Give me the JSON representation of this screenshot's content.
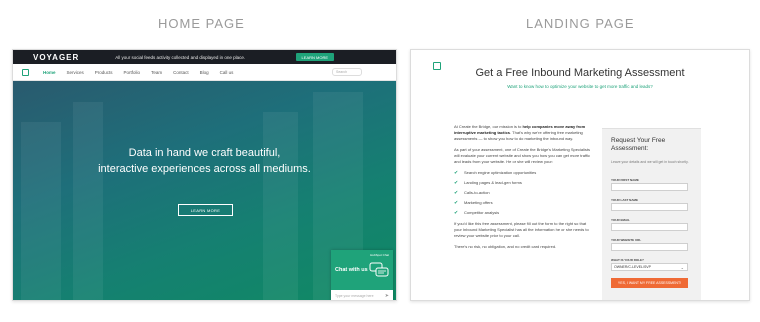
{
  "captions": {
    "home": "HOME PAGE",
    "landing": "LANDING PAGE"
  },
  "home": {
    "topbar": {
      "logo": "VOYAGER",
      "message": "All your social feeds activity collected and displayed in one place.",
      "button": "LEARN MORE"
    },
    "nav": {
      "items": [
        "Home",
        "Services",
        "Products",
        "Portfolio",
        "Team",
        "Contact",
        "Blog",
        "Call us"
      ],
      "search_placeholder": "Search"
    },
    "hero": {
      "line1": "Data in hand we craft beautiful,",
      "line2": "interactive experiences across all mediums.",
      "button": "LEARN MORE"
    },
    "chat": {
      "tag": "HubSpot Chat",
      "title": "Chat with us",
      "input_placeholder": "Type your message here"
    }
  },
  "landing": {
    "title": "Get a Free Inbound Marketing Assessment",
    "subtitle": "Want to know how to optimize your website to get more traffic and leads?",
    "body": {
      "p1_start": "At Create the Bridge, our mission is to ",
      "p1_bold": "help companies move away from interruptive marketing tactics",
      "p1_end": ". That's why we're offering free marketing assessments — to show you how to do marketing the inbound way.",
      "p2": "As part of your assessment, one of Create the Bridge's Marketing Specialists will evaluate your current website and show you how you can get more traffic and leads from your website. He or she will review your:",
      "checklist": [
        "Search engine optimization opportunities",
        "Landing pages & lead-gen forms",
        "Calls-to-action",
        "Marketing offers",
        "Competitor analysis"
      ],
      "p3": "If you'd like this free assessment, please fill out the form to the right so that your Inbound Marketing Specialist has all the information he or she needs to review your website prior to your call.",
      "p4": "There's no risk, no obligation, and no credit card required."
    },
    "form": {
      "title": "Request Your Free Assessment:",
      "description": "Leave your details and we will get in touch shortly.",
      "fields": [
        "YOUR FIRST NAME",
        "YOUR LAST NAME",
        "YOUR EMAIL",
        "YOUR WEBSITE URL"
      ],
      "select_label": "WHAT IS YOUR ROLE?",
      "select_value": "OWNER/C-LEVEL/SVP",
      "submit": "YES, I WANT MY FREE ASSESSMENT!"
    }
  },
  "colors": {
    "accent": "#1fa37a",
    "cta": "#ef6a35"
  }
}
